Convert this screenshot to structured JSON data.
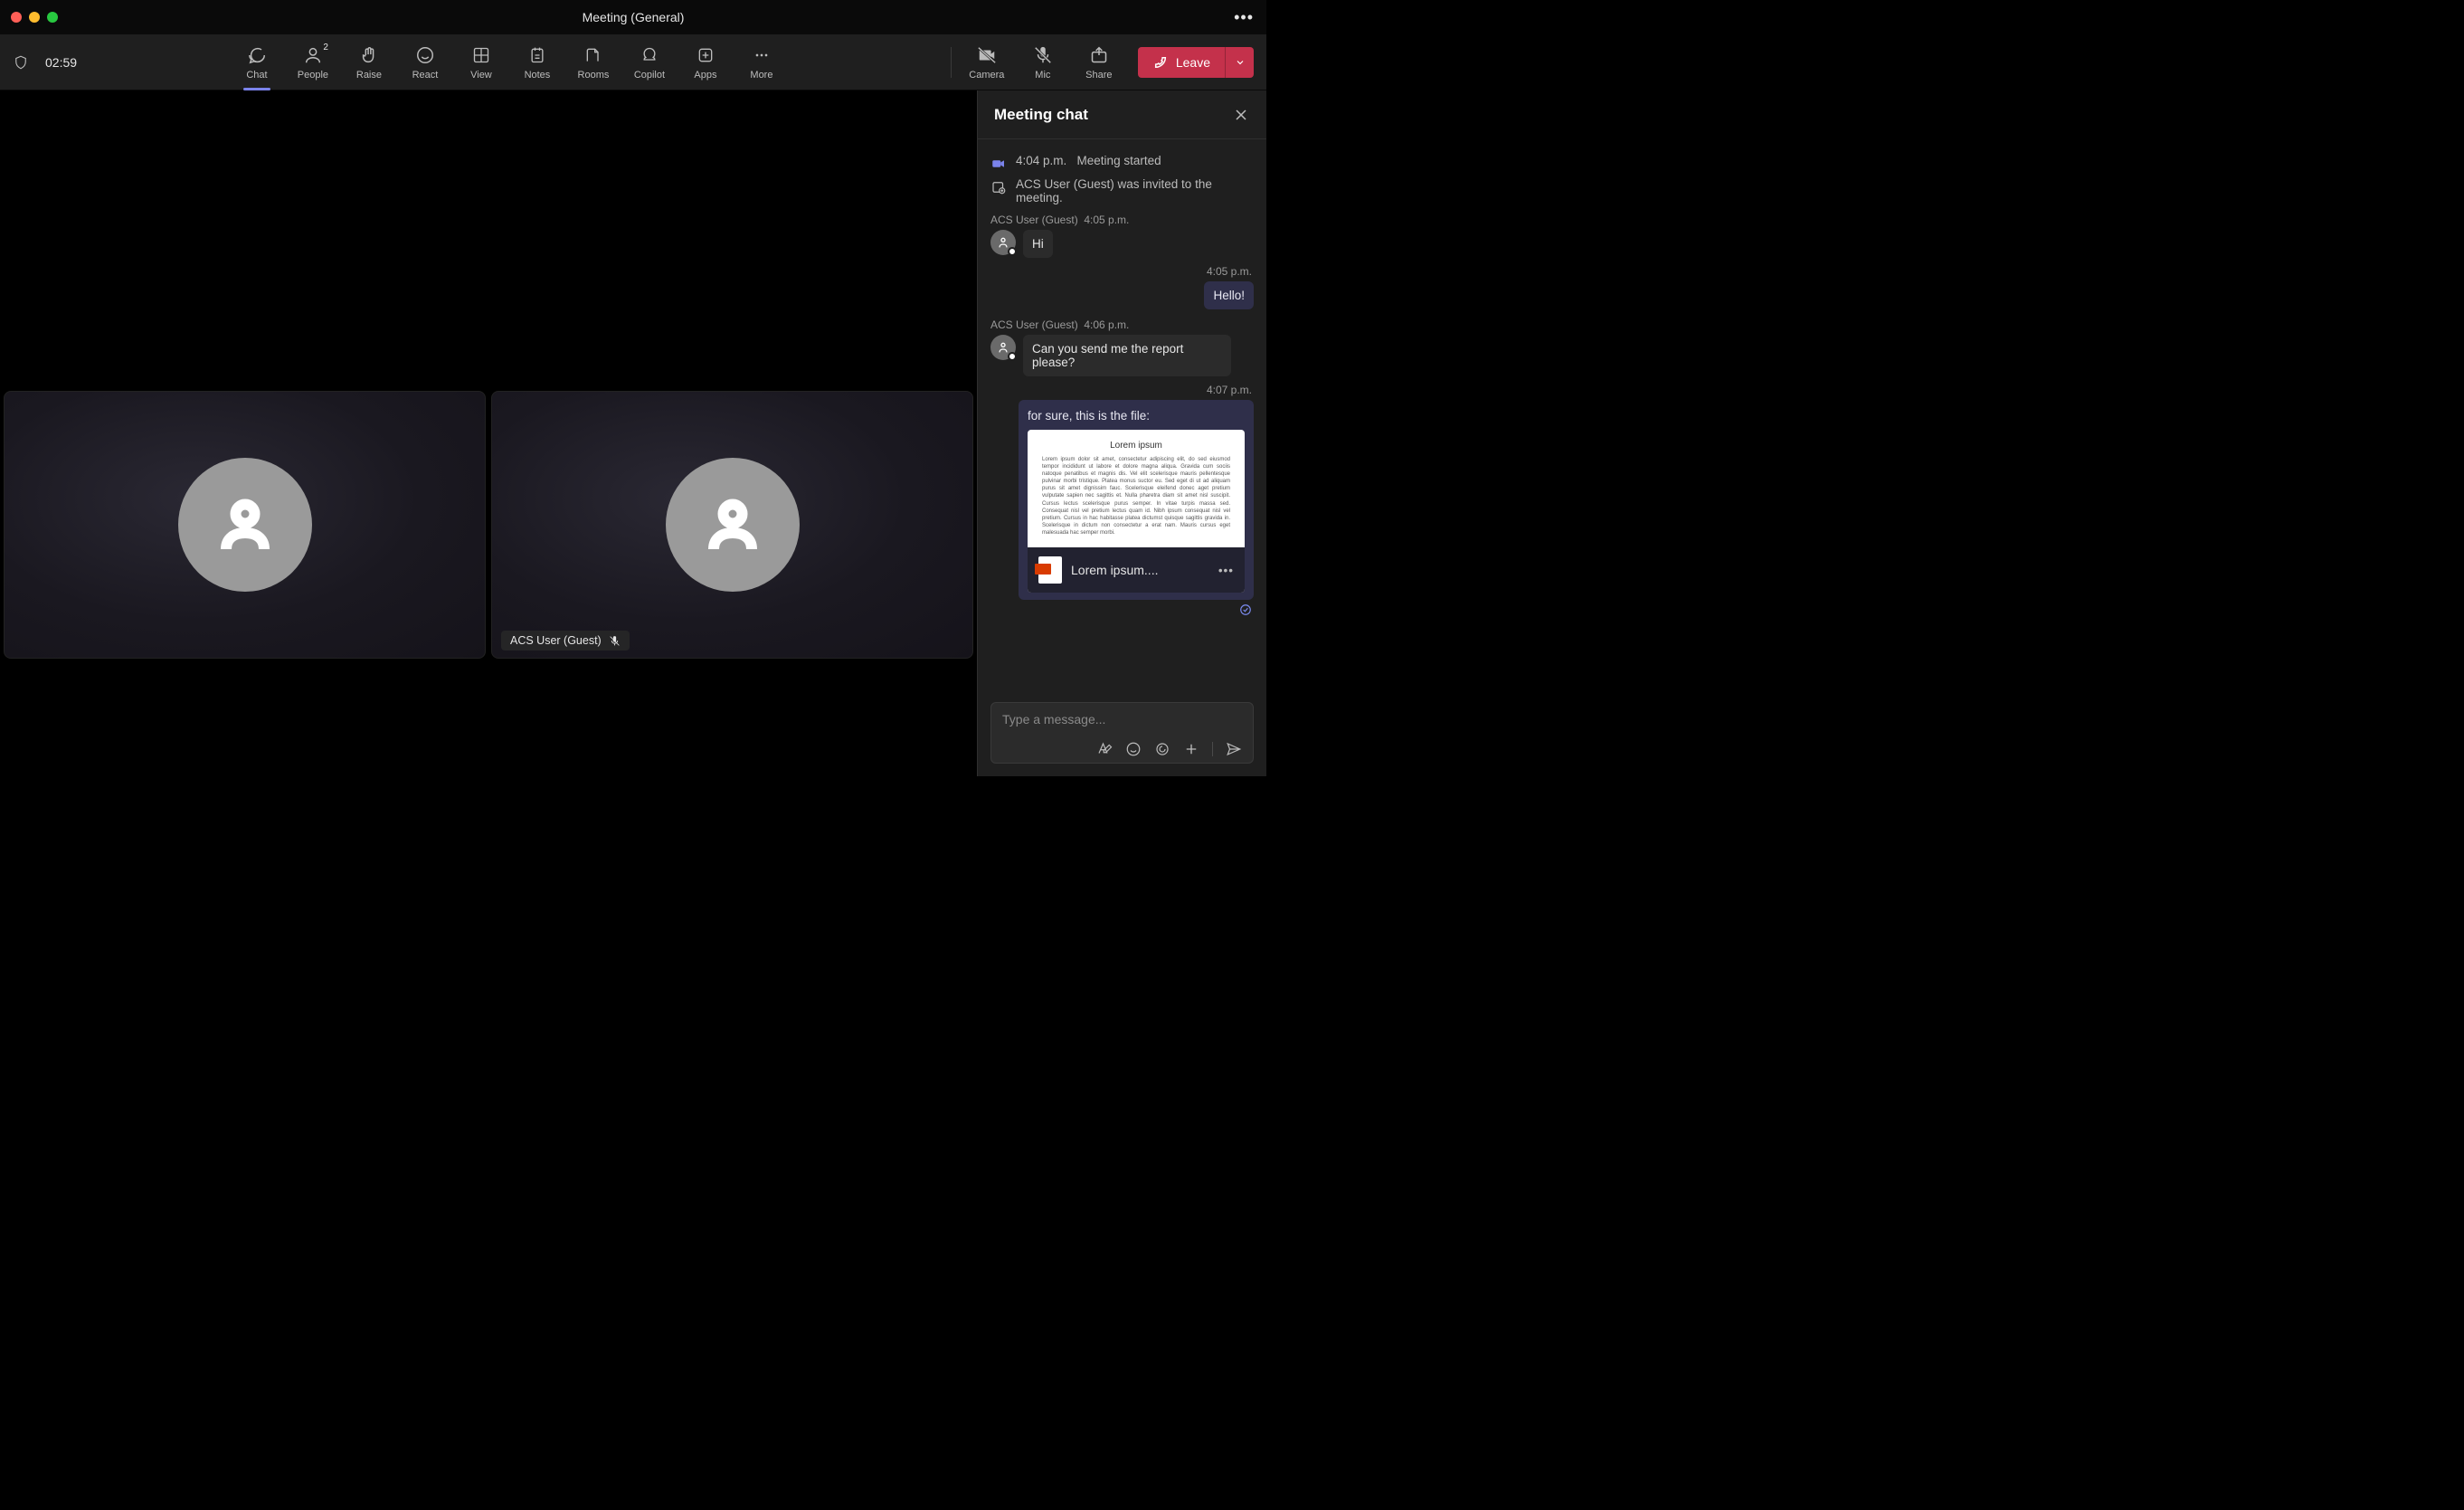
{
  "window_title": "Meeting (General)",
  "timer": "02:59",
  "toolbar": {
    "chat": "Chat",
    "people": "People",
    "people_count": "2",
    "raise": "Raise",
    "react": "React",
    "view": "View",
    "notes": "Notes",
    "rooms": "Rooms",
    "copilot": "Copilot",
    "apps": "Apps",
    "more": "More",
    "camera": "Camera",
    "mic": "Mic",
    "share": "Share",
    "leave": "Leave"
  },
  "participants": {
    "p2_name": "ACS User (Guest)"
  },
  "chat": {
    "title": "Meeting chat",
    "sys1_time": "4:04 p.m.",
    "sys1_text": "Meeting started",
    "sys2_text": "ACS User (Guest) was invited to the meeting.",
    "m1_author": "ACS User (Guest)",
    "m1_time": "4:05 p.m.",
    "m1_text": "Hi",
    "m2_time": "4:05 p.m.",
    "m2_text": "Hello!",
    "m3_author": "ACS User (Guest)",
    "m3_time": "4:06 p.m.",
    "m3_text": "Can you send me the report please?",
    "m4_time": "4:07 p.m.",
    "m4_text": "for sure, this is the file:",
    "file_preview_title": "Lorem ipsum",
    "file_preview_body": "Lorem ipsum dolor sit amet, consectetur adipiscing elit, do sed eiusmod tempor incididunt ut labore et dolore magna aliqua. Gravida cum sociis natoque penatibus et magnis dis. Vel elit scelerisque mauris pellentesque pulvinar morbi tristique. Platea monus suctor eu. Sed eget di ut ad aliquam purus sit amet dignissim fauc. Scelerisque eleifend donec aget pretium vulputate sapien nec sagittis et. Nulla pharetra diam sit amet nisl suscipit. Cursus lectus scelerisque purus semper. In vitae turpis massa sed. Consequat nisl vel pretium lectus quam id. Nibh ipsum consequat nisl vel pretium. Cursus in hac habitasse platea dictumst quisque sagittis gravida in. Scelerisque in dictum non consectetur a erat nam. Mauris cursus eget malesuada hac semper morbi.",
    "file_name": "Lorem ipsum....",
    "compose_placeholder": "Type a message..."
  }
}
